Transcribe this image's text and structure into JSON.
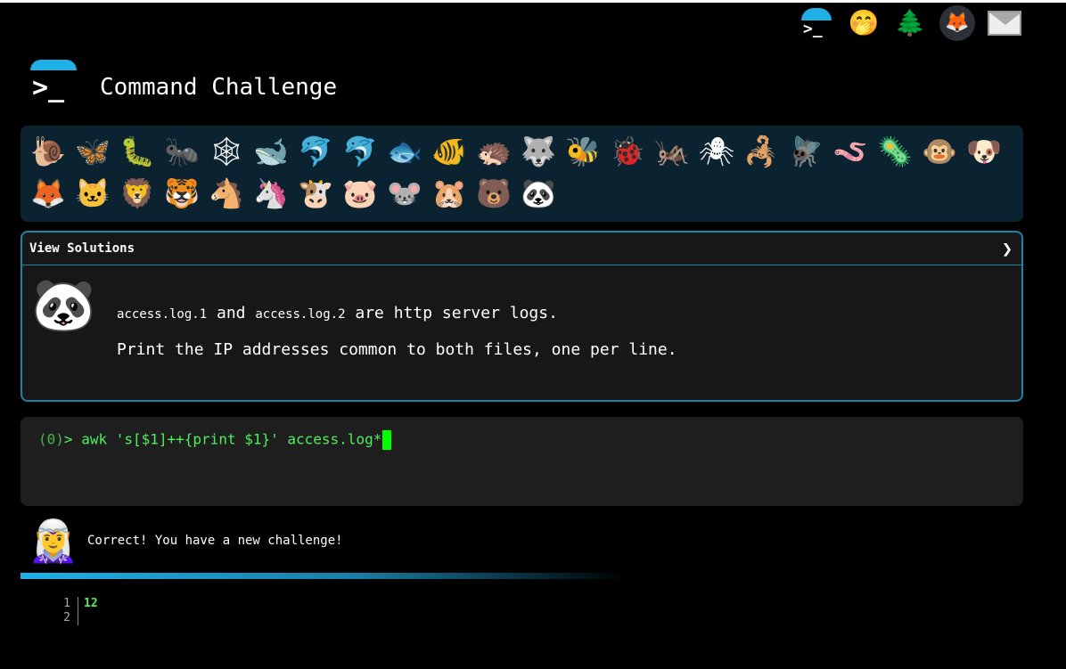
{
  "header": {
    "title": "Command Challenge",
    "top_icons": [
      "terminal-logo-icon",
      "face-with-hand-over-mouth-icon",
      "evergreen-tree-icon",
      "gitlab-icon",
      "envelope-icon"
    ]
  },
  "animals": {
    "icons": [
      "🐌",
      "🦋",
      "🐛",
      "🐜",
      "🕸",
      "🐋",
      "🐬",
      "🐬",
      "🐟",
      "🐠",
      "🦔",
      "🐺",
      "🐝",
      "🐞",
      "🦗",
      "🕷",
      "🦂",
      "🪰",
      "🪱",
      "🦠",
      "🐵",
      "🐶",
      "🦊",
      "🐱",
      "🦁",
      "🐯",
      "🐴",
      "🦄",
      "🐮",
      "🐷",
      "🐭",
      "🐹",
      "🐻",
      "🐼"
    ]
  },
  "solutions": {
    "label": "View Solutions",
    "chevron": "❯",
    "line1": {
      "file1": "access.log.1",
      "and": "and",
      "file2": "access.log.2",
      "rest": "are http server logs."
    },
    "line2": "Print the IP addresses common to both files, one per line."
  },
  "terminal": {
    "status": "(0)",
    "prompt": ">",
    "command": "awk 's[$1]++{print $1}' access.log*"
  },
  "feedback": {
    "message": "Correct! You have a new challenge!"
  },
  "output": {
    "lines": [
      {
        "num": "1",
        "text": "12"
      },
      {
        "num": "2",
        "text": ""
      }
    ]
  },
  "colors": {
    "accent": "#1eb0e6",
    "terminal_green": "#4ef05c",
    "panel_bg": "#0b2331"
  }
}
